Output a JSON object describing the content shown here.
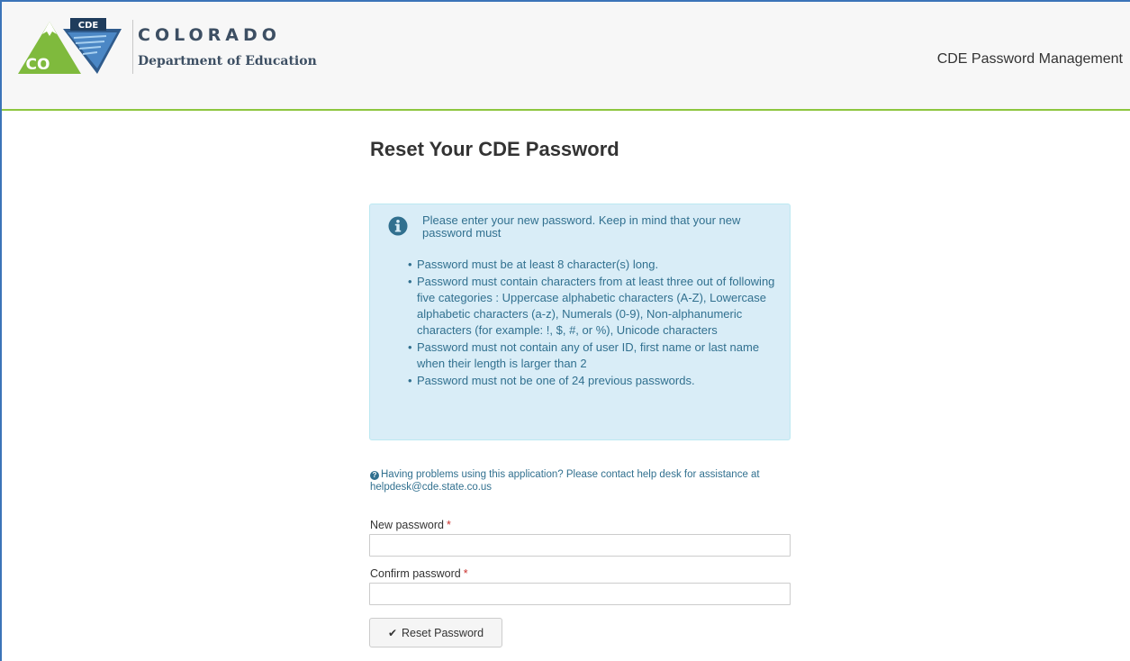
{
  "header": {
    "org_name": "COLORADO",
    "org_sub": "Department of Education",
    "logo_badge": "CDE",
    "logo_state": "CO",
    "app_title": "CDE Password Management"
  },
  "page": {
    "title": "Reset Your CDE Password"
  },
  "info": {
    "intro": "Please enter your new password. Keep in mind that your new password must",
    "rules": [
      "Password must be at least 8 character(s) long.",
      "Password must contain characters from at least three out of following five categories : Uppercase alphabetic characters (A-Z), Lowercase alphabetic characters (a-z), Numerals (0-9), Non-alphanumeric characters (for example: !, $, #, or %), Unicode characters",
      "Password must not contain any of user ID, first name or last name when their length is larger than 2",
      "Password must not be one of 24 previous passwords."
    ]
  },
  "help": {
    "text": "Having problems using this application? Please contact help desk for assistance at helpdesk@cde.state.co.us"
  },
  "form": {
    "new_password_label": "New password",
    "confirm_password_label": "Confirm password",
    "required_mark": "*",
    "new_password_value": "",
    "confirm_password_value": "",
    "submit_label": "Reset Password"
  },
  "colors": {
    "frame": "#3b74b8",
    "header_rule": "#8dc63f",
    "info_bg": "#d9edf7",
    "info_text": "#31708f",
    "required": "#c9302c"
  },
  "icons": {
    "info": "info-circle-icon",
    "help": "question-circle-icon",
    "submit": "checkmark-icon"
  }
}
